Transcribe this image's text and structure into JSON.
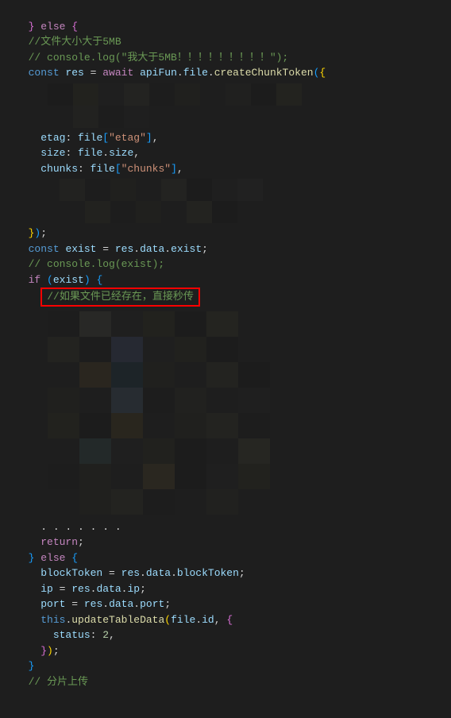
{
  "code": {
    "line1_else": "} else {",
    "line2_comment": "//文件大小大于5MB",
    "line3_comment": "// console.log(\"我大于5MB！！！！！！！！！\");",
    "line4_const": "const",
    "line4_res": "res",
    "line4_eq": " = ",
    "line4_await": "await",
    "line4_api": " apiFun",
    "line4_file": "file",
    "line4_create": "createChunkToken",
    "line7_etag": "etag",
    "line7_colon": ": ",
    "line7_file": "file",
    "line7_key": "\"etag\"",
    "line8_size": "size",
    "line8_file": "file",
    "line8_prop": "size",
    "line9_chunks": "chunks",
    "line9_file": "file",
    "line9_key": "\"chunks\"",
    "line12_close": "});",
    "line13_const": "const",
    "line13_exist": "exist",
    "line13_res": "res",
    "line13_data": "data",
    "line13_exist2": "exist",
    "line14_comment": "// console.log(exist);",
    "line15_if": "if",
    "line15_exist": "exist",
    "line16_comment": "//如果文件已经存在，直接秒传",
    "line25_return": "return",
    "line26_else": "} else {",
    "line27_bt": "blockToken",
    "line27_res": "res",
    "line27_data": "data",
    "line27_bt2": "blockToken",
    "line28_ip": "ip",
    "line28_res": "res",
    "line28_data": "data",
    "line28_ip2": "ip",
    "line29_port": "port",
    "line29_res": "res",
    "line29_data": "data",
    "line29_port2": "port",
    "line30_this": "this",
    "line30_upd": "updateTableData",
    "line30_file": "file",
    "line30_id": "id",
    "line31_status": "status",
    "line31_val": "2",
    "line32_close": "});",
    "line33_close": "}",
    "line34_comment": "// 分片上传"
  }
}
